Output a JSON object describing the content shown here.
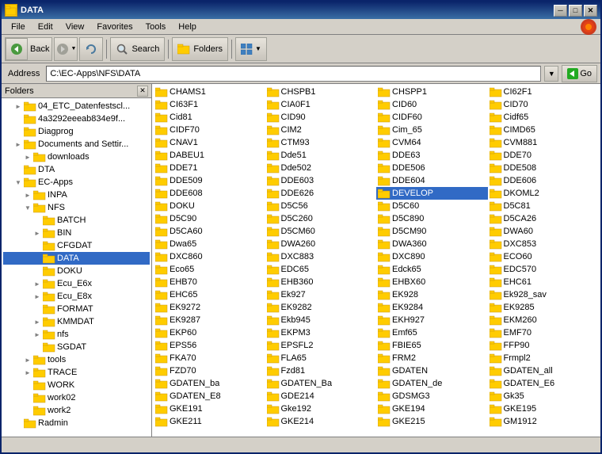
{
  "window": {
    "title": "DATA",
    "title_icon": "📁"
  },
  "title_buttons": {
    "minimize": "─",
    "maximize": "□",
    "close": "✕"
  },
  "menu": {
    "items": [
      "File",
      "Edit",
      "View",
      "Favorites",
      "Tools",
      "Help"
    ]
  },
  "toolbar": {
    "back_label": "Back",
    "forward_label": "",
    "refresh_label": "",
    "search_label": "Search",
    "folders_label": "Folders",
    "views_label": ""
  },
  "address_bar": {
    "label": "Address",
    "value": "C:\\EC-Apps\\NFS\\DATA",
    "go_label": "Go"
  },
  "folders_panel": {
    "title": "Folders",
    "tree": [
      {
        "id": "04_ETC",
        "label": "04_ETC_Datenfestscl...",
        "indent": 1,
        "expanded": false,
        "has_children": true
      },
      {
        "id": "4a3292",
        "label": "4a3292eeeab834e9f...",
        "indent": 1,
        "expanded": false,
        "has_children": false
      },
      {
        "id": "diagprog",
        "label": "Diagprog",
        "indent": 1,
        "expanded": false,
        "has_children": false
      },
      {
        "id": "documents",
        "label": "Documents and Settir...",
        "indent": 1,
        "expanded": false,
        "has_children": true
      },
      {
        "id": "downloads",
        "label": "downloads",
        "indent": 2,
        "expanded": false,
        "has_children": true
      },
      {
        "id": "dta",
        "label": "DTA",
        "indent": 1,
        "expanded": false,
        "has_children": false
      },
      {
        "id": "ec-apps",
        "label": "EC-Apps",
        "indent": 1,
        "expanded": true,
        "has_children": true
      },
      {
        "id": "inpa",
        "label": "INPA",
        "indent": 2,
        "expanded": false,
        "has_children": true
      },
      {
        "id": "nfs",
        "label": "NFS",
        "indent": 2,
        "expanded": true,
        "has_children": true
      },
      {
        "id": "batch",
        "label": "BATCH",
        "indent": 3,
        "expanded": false,
        "has_children": false
      },
      {
        "id": "bin",
        "label": "BIN",
        "indent": 3,
        "expanded": false,
        "has_children": true
      },
      {
        "id": "cfgdat",
        "label": "CFGDAT",
        "indent": 3,
        "expanded": false,
        "has_children": false
      },
      {
        "id": "data",
        "label": "DATA",
        "indent": 3,
        "expanded": true,
        "has_children": false,
        "selected": true
      },
      {
        "id": "doku",
        "label": "DOKU",
        "indent": 3,
        "expanded": false,
        "has_children": false
      },
      {
        "id": "ecu_e6x1",
        "label": "Ecu_E6x",
        "indent": 3,
        "expanded": false,
        "has_children": true
      },
      {
        "id": "ecu_e8x",
        "label": "Ecu_E8x",
        "indent": 3,
        "expanded": false,
        "has_children": true
      },
      {
        "id": "format",
        "label": "FORMAT",
        "indent": 3,
        "expanded": false,
        "has_children": false
      },
      {
        "id": "kmmdat",
        "label": "KMMDAT",
        "indent": 3,
        "expanded": false,
        "has_children": true
      },
      {
        "id": "nfs2",
        "label": "nfs",
        "indent": 3,
        "expanded": false,
        "has_children": true
      },
      {
        "id": "sgdat",
        "label": "SGDAT",
        "indent": 3,
        "expanded": false,
        "has_children": false
      },
      {
        "id": "tools",
        "label": "tools",
        "indent": 2,
        "expanded": false,
        "has_children": true
      },
      {
        "id": "trace",
        "label": "TRACE",
        "indent": 2,
        "expanded": false,
        "has_children": true
      },
      {
        "id": "work",
        "label": "WORK",
        "indent": 2,
        "expanded": false,
        "has_children": false
      },
      {
        "id": "work02",
        "label": "work02",
        "indent": 2,
        "expanded": false,
        "has_children": false
      },
      {
        "id": "work2",
        "label": "work2",
        "indent": 2,
        "expanded": false,
        "has_children": false
      },
      {
        "id": "radmin",
        "label": "Radmin",
        "indent": 1,
        "expanded": false,
        "has_children": false
      }
    ]
  },
  "files": [
    "CHAMS1",
    "CHSPB1",
    "CHSPP1",
    "CI62F1",
    "CI63F1",
    "CIA0F1",
    "CID60",
    "CID70",
    "Cid81",
    "CID90",
    "CIDF60",
    "Cidf65",
    "CIDF70",
    "CIM2",
    "Cim_65",
    "CIMD65",
    "CNAV1",
    "CTM93",
    "CVM64",
    "CVM881",
    "DABEU1",
    "Dde51",
    "DDE63",
    "DDE70",
    "DDE71",
    "Dde502",
    "DDE506",
    "DDE508",
    "DDE509",
    "DDE603",
    "DDE604",
    "DDE606",
    "DDE608",
    "DDE626",
    "DEVELOP",
    "DKOML2",
    "DOKU",
    "D5C56",
    "D5C60",
    "D5C81",
    "D5C90",
    "D5C260",
    "D5C890",
    "D5CA26",
    "D5CA60",
    "D5CM60",
    "D5CM90",
    "DWA60",
    "Dwa65",
    "DWA260",
    "DWA360",
    "DXC853",
    "DXC860",
    "DXC883",
    "DXC890",
    "ECO60",
    "Eco65",
    "EDC65",
    "Edck65",
    "EDC570",
    "EHB70",
    "EHB360",
    "EHBX60",
    "EHC61",
    "EHC65",
    "Ek927",
    "EK928",
    "Ek928_sav",
    "EK9272",
    "EK9282",
    "EK9284",
    "EK9285",
    "EK9287",
    "Ekb945",
    "EKH927",
    "EKM260",
    "EKP60",
    "EKPM3",
    "Emf65",
    "EMF70",
    "EPS56",
    "EPSFL2",
    "FBIE65",
    "FFP90",
    "FKA70",
    "FLA65",
    "FRM2",
    "Frmpl2",
    "FZD70",
    "Fzd81",
    "GDATEN",
    "GDATEN_all",
    "GDATEN_ba",
    "GDATEN_Ba",
    "GDATEN_de",
    "GDATEN_E6",
    "GDATEN_E8",
    "GDE214",
    "GDSMG3",
    "Gk35",
    "GKE191",
    "Gke192",
    "GKE194",
    "GKE195",
    "GKE211",
    "GKE214",
    "GKE215",
    "GM1912"
  ],
  "colors": {
    "selected_bg": "#316ac5",
    "folder_yellow": "#ffcc00",
    "folder_yellow2": "#ffe066",
    "folder_brown": "#c8960c"
  }
}
